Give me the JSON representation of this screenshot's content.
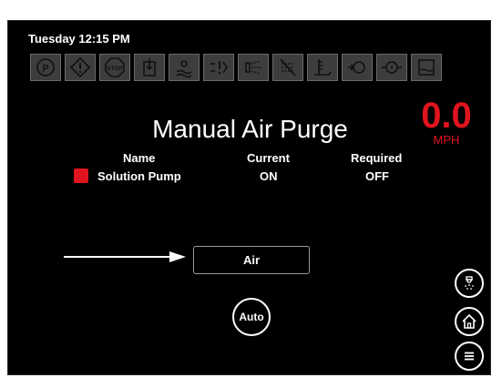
{
  "status_bar": {
    "datetime": "Tuesday 12:15 PM"
  },
  "warning_icons": [
    "parking-brake-icon",
    "warning-icon",
    "stop-icon",
    "tank-level-icon",
    "water-level-icon",
    "spray-fault-icon",
    "spray-flow-icon",
    "spray-off-icon",
    "level-gauge-icon",
    "pump-icon",
    "engine-oil-icon",
    "tank-empty-icon"
  ],
  "page": {
    "title": "Manual Air Purge"
  },
  "speed": {
    "value": "0.0",
    "unit": "MPH"
  },
  "table": {
    "headers": {
      "name": "Name",
      "current": "Current",
      "required": "Required"
    },
    "rows": [
      {
        "name": "Solution Pump",
        "current": "ON",
        "required": "OFF",
        "status_color": "#e0141e"
      }
    ]
  },
  "buttons": {
    "air": "Air",
    "auto": "Auto"
  },
  "side_buttons": [
    "spray-nozzle-icon",
    "home-icon",
    "menu-icon"
  ],
  "colors": {
    "accent_red": "#e0141e",
    "tile_bg": "#3d3d3d"
  }
}
